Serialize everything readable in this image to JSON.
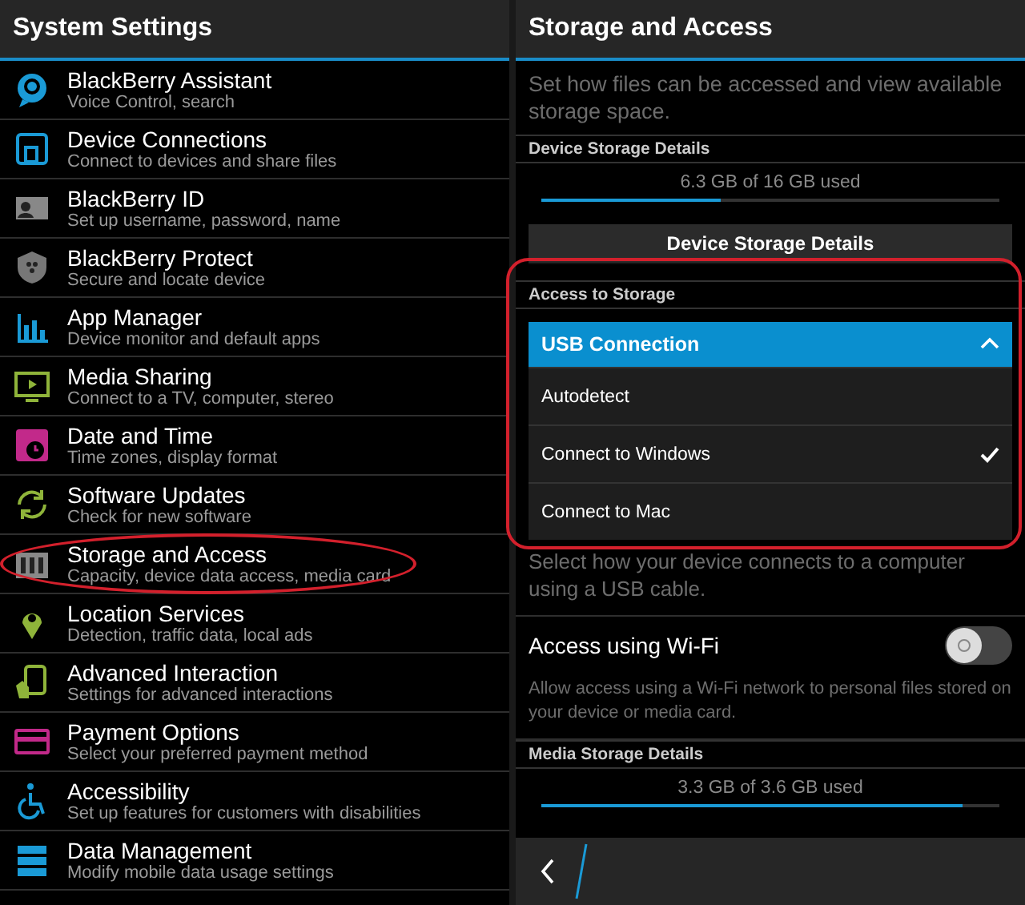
{
  "settings_screen": {
    "title": "System Settings",
    "items": [
      {
        "title": "BlackBerry Assistant",
        "subtitle": "Voice Control, search",
        "circled": false
      },
      {
        "title": "Device Connections",
        "subtitle": "Connect to devices and share files",
        "circled": false
      },
      {
        "title": "BlackBerry ID",
        "subtitle": "Set up username, password, name",
        "circled": false
      },
      {
        "title": "BlackBerry Protect",
        "subtitle": "Secure and locate device",
        "circled": false
      },
      {
        "title": "App Manager",
        "subtitle": "Device monitor and default apps",
        "circled": false
      },
      {
        "title": "Media Sharing",
        "subtitle": "Connect to a TV, computer, stereo",
        "circled": false
      },
      {
        "title": "Date and Time",
        "subtitle": "Time zones, display format",
        "circled": false
      },
      {
        "title": "Software Updates",
        "subtitle": "Check for new software",
        "circled": false
      },
      {
        "title": "Storage and Access",
        "subtitle": "Capacity, device data access, media card",
        "circled": true
      },
      {
        "title": "Location Services",
        "subtitle": "Detection, traffic data, local ads",
        "circled": false
      },
      {
        "title": "Advanced Interaction",
        "subtitle": "Settings for advanced interactions",
        "circled": false
      },
      {
        "title": "Payment Options",
        "subtitle": "Select your preferred payment method",
        "circled": false
      },
      {
        "title": "Accessibility",
        "subtitle": "Set up features for customers with disabilities",
        "circled": false
      },
      {
        "title": "Data Management",
        "subtitle": "Modify mobile data usage settings",
        "circled": false
      }
    ]
  },
  "storage_screen": {
    "title": "Storage and Access",
    "description": "Set how files can be accessed and view available storage space.",
    "device_storage": {
      "header": "Device Storage Details",
      "usage": "6.3 GB of 16 GB used",
      "level": 0.39,
      "button": "Device Storage Details"
    },
    "access": {
      "header": "Access to Storage",
      "circled": true,
      "dropdown": {
        "label": "USB Connection",
        "expanded": true,
        "options": [
          {
            "label": "Autodetect",
            "selected": false
          },
          {
            "label": "Connect to Windows",
            "selected": true
          },
          {
            "label": "Connect to Mac",
            "selected": false
          }
        ]
      },
      "usb_hint": "Select how your device connects to a computer using a USB cable.",
      "wifi": {
        "label": "Access using Wi-Fi",
        "on": false,
        "hint": "Allow access using a Wi-Fi network to personal files stored on your device or media card."
      }
    },
    "media_storage": {
      "header": "Media Storage Details",
      "usage": "3.3 GB of 3.6 GB used",
      "level": 0.92
    }
  }
}
